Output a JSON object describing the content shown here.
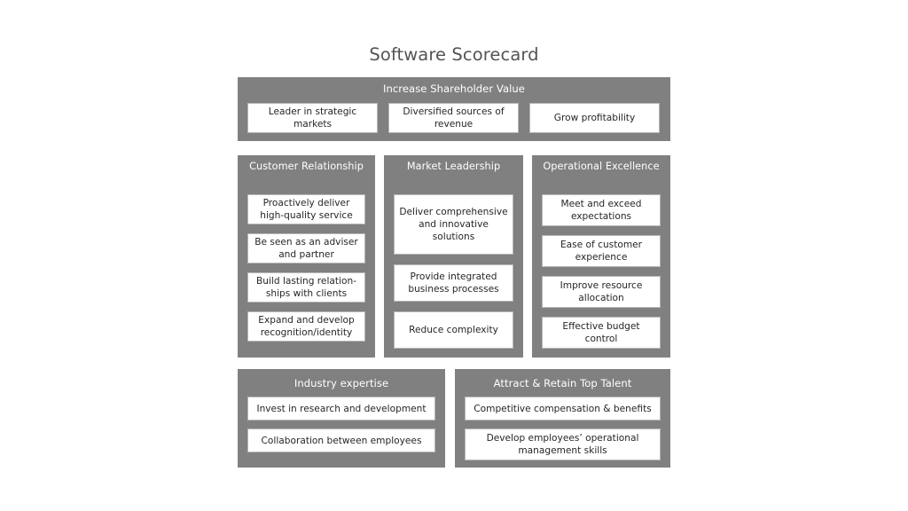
{
  "title": "Software Scorecard",
  "colors": {
    "panel_gray": "#808080",
    "card_white": "#ffffff",
    "card_border": "#b7b7b7",
    "title_text": "#545454",
    "panel_title_text": "#ffffff",
    "card_text": "#262626"
  },
  "top_panel": {
    "title": "Increase Shareholder Value",
    "cards": [
      "Leader in strategic markets",
      "Diversified sources of revenue",
      "Grow profitability"
    ]
  },
  "columns": [
    {
      "title": "Customer Relationship",
      "cards": [
        "Proactively deliver high-quality service",
        "Be seen as an adviser and partner",
        "Build lasting relation-ships with clients",
        "Expand and develop recognition/identity"
      ]
    },
    {
      "title": "Market Leadership",
      "cards": [
        "Deliver comprehensive and innovative solutions",
        "Provide integrated business processes",
        "Reduce complexity"
      ]
    },
    {
      "title": "Operational Excellence",
      "cards": [
        "Meet and exceed expectations",
        "Ease of customer experience",
        "Improve resource allocation",
        "Effective budget control"
      ]
    }
  ],
  "bottom_panels": [
    {
      "title": "Industry expertise",
      "cards": [
        "Invest in research and development",
        "Collaboration between employees"
      ]
    },
    {
      "title": "Attract & Retain Top Talent",
      "cards": [
        "Competitive compensation & benefits",
        "Develop employees’ operational management skills"
      ]
    }
  ]
}
